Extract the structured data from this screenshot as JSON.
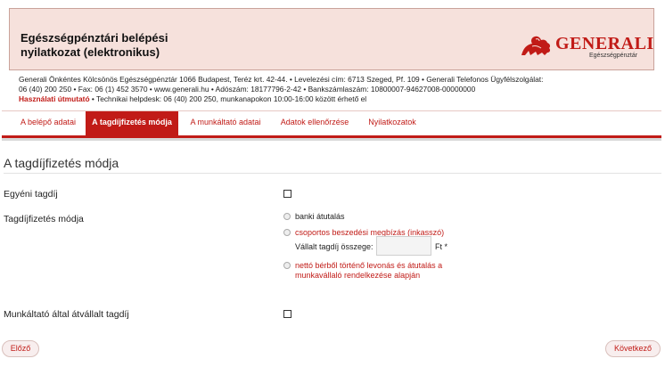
{
  "header": {
    "title_line1": "Egészségpénztári belépési",
    "title_line2": "nyilatkozat (elektronikus)",
    "logo_text": "GENERALI",
    "logo_subtext": "Egészségpénztár"
  },
  "info": {
    "line1": "Generali Önkéntes Kölcsönös Egészségpénztár 1066 Budapest, Teréz krt. 42-44. • Levelezési cím: 6713 Szeged, Pf. 109 • Generali Telefonos Ügyfélszolgálat:",
    "line2": "06 (40) 200 250 • Fax: 06 (1) 452 3570 • www.generali.hu • Adószám: 18177796-2-42 • Bankszámlaszám: 10800007-94627008-00000000",
    "guide_link": "Használati útmutató",
    "line3_rest": " • Technikai helpdesk: 06 (40) 200 250, munkanapokon 10:00-16:00 között érhető el"
  },
  "tabs": [
    {
      "label": "A belépő adatai"
    },
    {
      "label": "A tagdíjfizetés módja"
    },
    {
      "label": "A munkáltató adatai"
    },
    {
      "label": "Adatok ellenőrzése"
    },
    {
      "label": "Nyilatkozatok"
    }
  ],
  "active_tab_index": 1,
  "section": {
    "title": "A tagdíjfizetés módja"
  },
  "form": {
    "individual_fee_label": "Egyéni tagdíj",
    "individual_fee_checked": false,
    "payment_method_label": "Tagdíjfizetés módja",
    "options": [
      {
        "label": "banki átutalás"
      },
      {
        "label": "csoportos beszedési megbízás (inkasszó)"
      },
      {
        "label_line1": "nettó bérből történő levonás és átutalás a",
        "label_line2": "munkavállaló rendelkezése alapján"
      }
    ],
    "amount_label": "Vállalt tagdíj összege:",
    "amount_value": "",
    "amount_unit": "Ft *",
    "employer_fee_label": "Munkáltató által átvállalt tagdíj",
    "employer_fee_checked": false
  },
  "buttons": {
    "prev": "Előző",
    "next": "Következő"
  },
  "colors": {
    "brand_red": "#c11b17",
    "header_bg": "#f6e1dc"
  }
}
